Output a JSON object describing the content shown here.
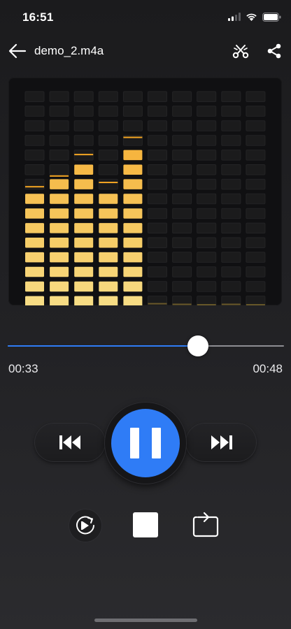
{
  "status_bar": {
    "time": "16:51"
  },
  "header": {
    "title": "demo_2.m4a"
  },
  "visualizer": {
    "columns": 10,
    "rows": 15,
    "levels": [
      0.55,
      0.6,
      0.7,
      0.57,
      0.78,
      0.005,
      0.002,
      0,
      0.002,
      0
    ],
    "peaks": [
      0.55,
      0.6,
      0.7,
      0.57,
      0.78,
      0.005,
      0.002,
      0,
      0.002,
      0
    ],
    "colors": {
      "top": "#f5a623",
      "bottom": "#f7dc84",
      "empty": "#1b1b1c"
    }
  },
  "player": {
    "current_time": "00:33",
    "total_time": "00:48",
    "progress": 0.6875
  },
  "colors": {
    "accent": "#2f7cf6"
  },
  "icons": {
    "back": "arrow-left-icon",
    "scissors": "scissors-icon",
    "share": "share-icon",
    "previous": "skip-previous-icon",
    "pause": "pause-icon",
    "next": "skip-next-icon",
    "replay": "replay-icon",
    "stop": "stop-icon",
    "loop": "repeat-icon"
  }
}
